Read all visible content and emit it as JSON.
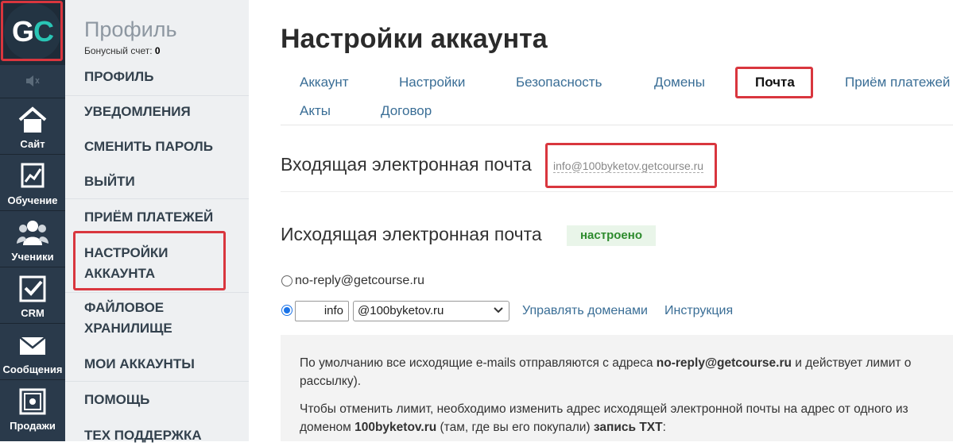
{
  "rail": {
    "logo_g": "G",
    "logo_c": "C",
    "items": [
      {
        "label": "Сайт",
        "icon": "home-icon"
      },
      {
        "label": "Обучение",
        "icon": "chart-icon"
      },
      {
        "label": "Ученики",
        "icon": "users-icon"
      },
      {
        "label": "CRM",
        "icon": "checkbox-icon"
      },
      {
        "label": "Сообщения",
        "icon": "envelope-icon"
      },
      {
        "label": "Продажи",
        "icon": "safe-icon"
      }
    ]
  },
  "menu": {
    "title": "Профиль",
    "bonus_label": "Бонусный счет:",
    "bonus_value": "0",
    "items": [
      {
        "line1": "ПРОФИЛЬ"
      },
      {
        "line1": "УВЕДОМЛЕНИЯ"
      },
      {
        "line1": "СМЕНИТЬ ПАРОЛЬ"
      },
      {
        "line1": "ВЫЙТИ"
      },
      {
        "line1": "ПРИЁМ ПЛАТЕЖЕЙ"
      },
      {
        "line1": "НАСТРОЙКИ",
        "line2": "АККАУНТА"
      },
      {
        "line1": "ФАЙЛОВОЕ",
        "line2": "ХРАНИЛИЩЕ"
      },
      {
        "line1": "МОИ АККАУНТЫ"
      },
      {
        "line1": "ПОМОЩЬ"
      },
      {
        "line1": "ТЕХ ПОДДЕРЖКА"
      }
    ]
  },
  "main": {
    "title": "Настройки аккаунта",
    "tabs": [
      {
        "label": "Аккаунт"
      },
      {
        "label": "Настройки"
      },
      {
        "label": "Безопасность"
      },
      {
        "label": "Домены"
      },
      {
        "label": "Почта",
        "active": true
      },
      {
        "label": "Приём платежей"
      },
      {
        "label": "Акты"
      },
      {
        "label": "Договор"
      }
    ],
    "incoming": {
      "label": "Входящая электронная почта",
      "email": "info@100byketov.getcourse.ru"
    },
    "outgoing": {
      "label": "Исходящая электронная почта",
      "status": "настроено",
      "option1": "no-reply@getcourse.ru",
      "local_part": "info",
      "domain": "@100byketov.ru",
      "manage_link": "Управлять доменами",
      "instructions_link": "Инструкция"
    },
    "info": {
      "p1_a": "По умолчанию все исходящие e-mails отправляются с адреса ",
      "p1_b": "no-reply@getcourse.ru",
      "p1_c": " и действует лимит о",
      "p1_d": "рассылку).",
      "p2_a": "Чтобы отменить лимит, необходимо изменить адрес исходящей электронной почты на адрес от одного из",
      "p2_b": "доменом ",
      "p2_c": "100byketov.ru",
      "p2_d": " (там, где вы его покупали) ",
      "p2_e": "запись TXT",
      "p2_f": ":"
    }
  },
  "colors": {
    "rail_bg": "#2a3a4b",
    "menu_bg": "#eef0f2",
    "link": "#3a6e96",
    "highlight": "#d9363e",
    "status_green": "#2e8b2e"
  }
}
